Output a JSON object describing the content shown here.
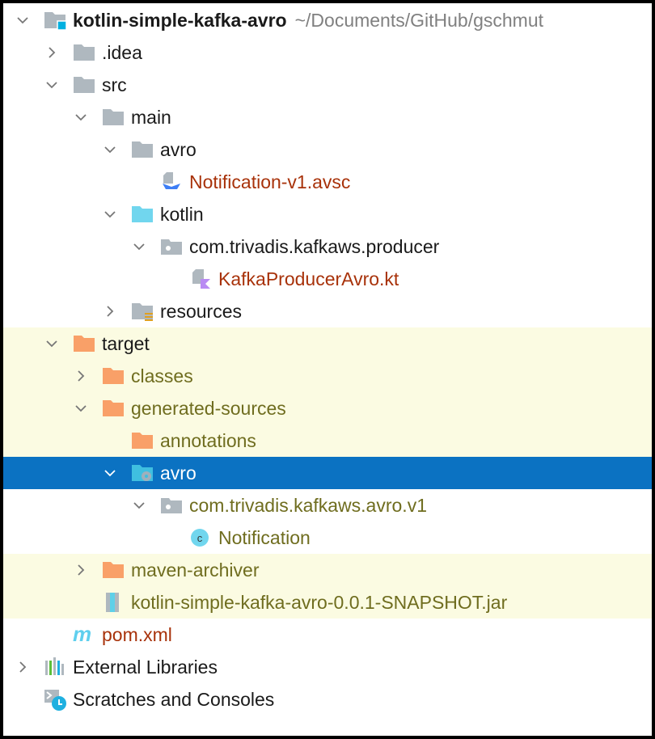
{
  "project_tree": {
    "root_path": "~/Documents/GitHub/gschmut",
    "items": [
      {
        "label": "kotlin-simple-kafka-avro",
        "level": 0,
        "state": "open",
        "icon": "module-folder-icon",
        "style": "bold"
      },
      {
        "label": ".idea",
        "level": 1,
        "state": "closed",
        "icon": "folder-icon"
      },
      {
        "label": "src",
        "level": 1,
        "state": "open",
        "icon": "folder-icon"
      },
      {
        "label": "main",
        "level": 2,
        "state": "open",
        "icon": "folder-icon"
      },
      {
        "label": "avro",
        "level": 3,
        "state": "open",
        "icon": "folder-icon"
      },
      {
        "label": "Notification-v1.avsc",
        "level": 4,
        "state": "none",
        "icon": "avro-file-icon",
        "style": "red"
      },
      {
        "label": "kotlin",
        "level": 3,
        "state": "open",
        "icon": "source-folder-icon"
      },
      {
        "label": "com.trivadis.kafkaws.producer",
        "level": 4,
        "state": "open",
        "icon": "package-icon"
      },
      {
        "label": "KafkaProducerAvro.kt",
        "level": 5,
        "state": "none",
        "icon": "kotlin-file-icon",
        "style": "red"
      },
      {
        "label": "resources",
        "level": 3,
        "state": "closed",
        "icon": "resources-folder-icon"
      },
      {
        "label": "target",
        "level": 1,
        "state": "open",
        "icon": "excluded-folder-icon",
        "bg": "excluded"
      },
      {
        "label": "classes",
        "level": 2,
        "state": "closed",
        "icon": "excluded-folder-icon",
        "style": "olive",
        "bg": "excluded"
      },
      {
        "label": "generated-sources",
        "level": 2,
        "state": "open",
        "icon": "excluded-folder-icon",
        "style": "olive",
        "bg": "excluded"
      },
      {
        "label": "annotations",
        "level": 3,
        "state": "none",
        "icon": "excluded-folder-icon",
        "style": "olive",
        "bg": "excluded"
      },
      {
        "label": "avro",
        "level": 3,
        "state": "open",
        "icon": "generated-source-folder-icon",
        "bg": "selected"
      },
      {
        "label": "com.trivadis.kafkaws.avro.v1",
        "level": 4,
        "state": "open",
        "icon": "package-icon",
        "style": "olive"
      },
      {
        "label": "Notification",
        "level": 5,
        "state": "none",
        "icon": "class-icon",
        "style": "olive"
      },
      {
        "label": "maven-archiver",
        "level": 2,
        "state": "closed",
        "icon": "excluded-folder-icon",
        "style": "olive",
        "bg": "excluded"
      },
      {
        "label": "kotlin-simple-kafka-avro-0.0.1-SNAPSHOT.jar",
        "level": 2,
        "state": "none",
        "icon": "jar-icon",
        "style": "olive",
        "bg": "excluded"
      },
      {
        "label": "pom.xml",
        "level": 1,
        "state": "none",
        "icon": "maven-icon",
        "style": "red"
      },
      {
        "label": "External Libraries",
        "level": 0,
        "state": "closed",
        "icon": "libraries-icon"
      },
      {
        "label": "Scratches and Consoles",
        "level": 0,
        "state": "none",
        "icon": "scratches-icon"
      }
    ]
  },
  "colors": {
    "selected": "#0b72c2",
    "excluded_bg": "#fbfbe2",
    "folder": "#afb8bf",
    "excluded_folder": "#f9a068",
    "source_folder": "#71d6ee"
  }
}
